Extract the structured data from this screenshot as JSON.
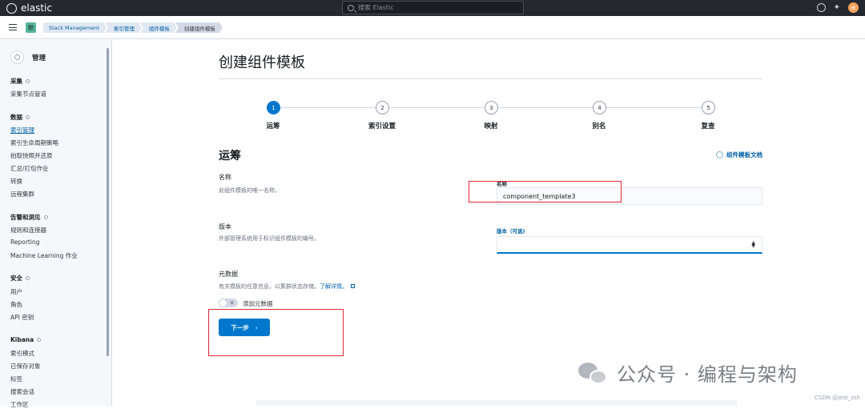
{
  "topbar": {
    "logo_text": "elastic",
    "search_placeholder": "搜索 Elastic",
    "avatar_letter": "e"
  },
  "breadcrumb": {
    "space_letter": "默",
    "items": [
      "Stack Management",
      "索引管理",
      "组件模板",
      "创建组件模板"
    ]
  },
  "sidebar": {
    "title": "管理",
    "groups": [
      {
        "label": "采集",
        "items": [
          "采集节点管道"
        ]
      },
      {
        "label": "数据",
        "items": [
          "索引管理",
          "索引生命周期策略",
          "拍取快照并还原",
          "汇总/打包作业",
          "转换",
          "远程集群"
        ]
      },
      {
        "label": "告警和洞见",
        "items": [
          "规则和连接器",
          "Reporting",
          "Machine Learning 作业"
        ]
      },
      {
        "label": "安全",
        "items": [
          "用户",
          "角色",
          "API 密钥"
        ]
      },
      {
        "label": "Kibana",
        "items": [
          "索引模式",
          "已保存对象",
          "标签",
          "搜索会话",
          "工作区"
        ]
      }
    ],
    "active_item": "索引管理"
  },
  "page": {
    "title": "创建组件模板"
  },
  "steps": [
    {
      "number": "1",
      "label": "运筹",
      "active": true
    },
    {
      "number": "2",
      "label": "索引设置",
      "active": false
    },
    {
      "number": "3",
      "label": "映射",
      "active": false
    },
    {
      "number": "4",
      "label": "别名",
      "active": false
    },
    {
      "number": "5",
      "label": "复查",
      "active": false
    }
  ],
  "section": {
    "title": "运筹",
    "docs_link": "组件模板文档"
  },
  "fields": {
    "name": {
      "title": "名称",
      "desc": "此组件模板的唯一名称。",
      "label": "名称",
      "value": "component_template3"
    },
    "version": {
      "title": "版本",
      "desc": "外部管理系统用于标识组件模板的编号。",
      "label": "版本（可选)",
      "value": ""
    },
    "meta": {
      "title": "元数据",
      "desc": "有关模板的任意信息，以集群状态存储。",
      "learn_more": "了解详情。",
      "toggle_label": "添加元数据"
    }
  },
  "next_button": {
    "label": "下一步"
  },
  "watermark": {
    "text": "公众号 · 编程与架构",
    "csdn": "CSDN @jest_zsh"
  },
  "colors": {
    "primary": "#0077cc",
    "highlight_box": "#e0283b",
    "topbar": "#25282f"
  }
}
